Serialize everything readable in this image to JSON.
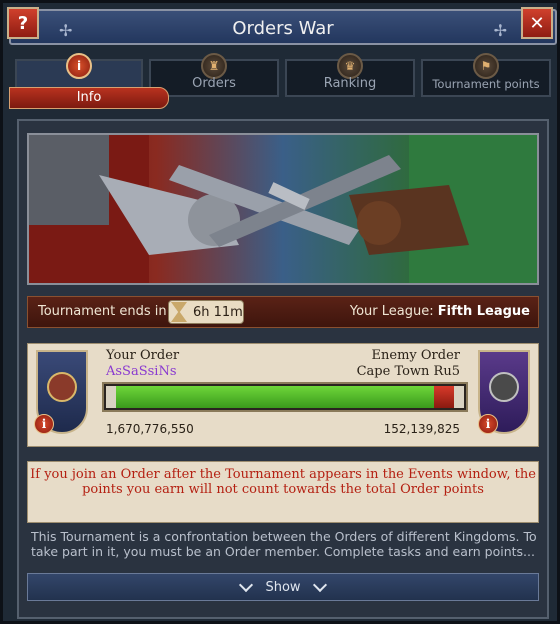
{
  "window": {
    "title": "Orders War",
    "help_label": "?",
    "close_label": "✕"
  },
  "tabs": [
    {
      "label": "Info",
      "icon": "info-icon",
      "active": true
    },
    {
      "label": "Orders",
      "icon": "order-crest-icon",
      "active": false
    },
    {
      "label": "Ranking",
      "icon": "ranking-crest-icon",
      "active": false
    },
    {
      "label": "Tournament points",
      "icon": "tournament-points-icon",
      "active": false
    }
  ],
  "tournament": {
    "ends_label": "Tournament ends in:",
    "time_left": "6h 11m",
    "league_label": "Your League:",
    "league_value": "Fifth League"
  },
  "your_order": {
    "label": "Your Order",
    "name": "AsSaSsiNs",
    "score": "1,670,776,550"
  },
  "enemy_order": {
    "label": "Enemy Order",
    "name": "Cape Town Ru5",
    "score": "152,139,825"
  },
  "progress": {
    "your_share": 0.917
  },
  "warning": "If you join an Order after the Tournament appears in the Events window, the points you earn will not count towards the total Order points",
  "description": "This Tournament is a confrontation between the Orders of different Kingdoms. To take part in it, you must be an Order member. Complete tasks and earn points...",
  "show_label": "Show",
  "colors": {
    "accent_red": "#b42012",
    "order_name": "#8a3ad0",
    "bar_green": "#5cc02e"
  }
}
